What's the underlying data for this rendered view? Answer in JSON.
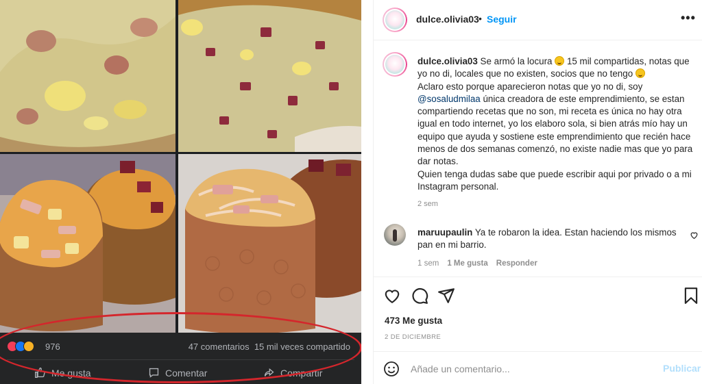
{
  "post_image": {
    "facebook_screenshot": {
      "reaction_count": "976",
      "comments_label": "47 comentarios",
      "shares_label": "15 mil veces compartido",
      "actions": [
        "Me gusta",
        "Comentar",
        "Compartir"
      ],
      "reaction_icons": [
        "heart-reaction-icon",
        "like-reaction-icon",
        "wow-reaction-icon"
      ]
    }
  },
  "header": {
    "username": "dulce.olivia03",
    "separator": "•",
    "follow_label": "Seguir",
    "more_label": "•••"
  },
  "caption": {
    "username": "dulce.olivia03",
    "line1_a": " Se armó la locura ",
    "line1_b": " 15 mil compartidas, notas que yo no di, locales que no existen, socios que no tengo ",
    "line2_a": "Aclaro esto porque aparecieron notas que yo no di, soy ",
    "mention": "@sosaludmilaa",
    "line2_b": " única creadora de este emprendimiento, se estan compartiendo recetas que no son, mi receta es única no hay otra igual en todo internet, yo los elaboro sola, si bien atrás mío hay un equipo que ayuda y sostiene este emprendimiento que recién hace menos de dos semanas comenzó, no existe nadie mas que yo para dar notas.",
    "line3": "Quien tenga dudas sabe que puede escribir aqui por privado o a mi Instagram personal.",
    "time": "2 sem"
  },
  "comment": {
    "username": "maruupaulin",
    "text": " Ya te robaron la idea. Estan haciendo los mismos pan en mi barrio.",
    "time": "1 sem",
    "likes": "1 Me gusta",
    "reply": "Responder"
  },
  "post_stats": {
    "likes": "473 Me gusta",
    "date": "2 DE DICIEMBRE"
  },
  "add_comment": {
    "placeholder": "Añade un comentario...",
    "publish_label": "Publicar"
  },
  "colors": {
    "accent": "#0095f6",
    "mention": "#00376b",
    "muted": "#8e8e8e",
    "publish_disabled": "#b2dffc",
    "highlight_ellipse": "#d4262c",
    "fb_dark": "#242526"
  }
}
